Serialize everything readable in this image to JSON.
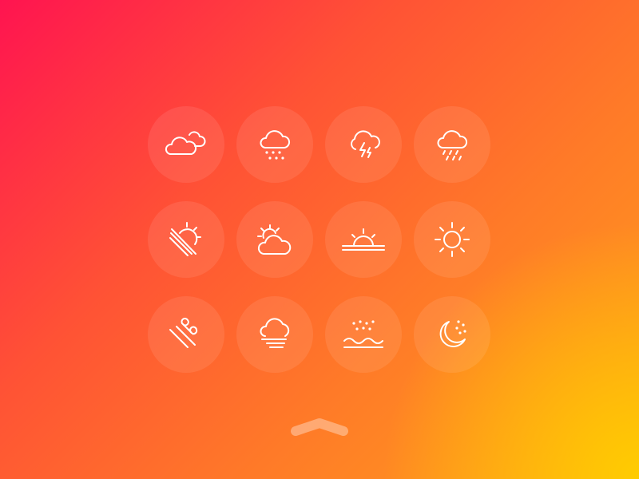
{
  "background": {
    "gradient_colors": [
      "#ff1450",
      "#ff5235",
      "#ff7a28",
      "#ffa31a",
      "#ffcc00"
    ]
  },
  "icon_color": "#ffffff",
  "icons": [
    [
      "cloudy-icon",
      "rain-icon",
      "thunderstorm-icon",
      "heavy-rain-icon"
    ],
    [
      "sunset-haze-icon",
      "partly-cloudy-icon",
      "sunrise-icon",
      "sun-icon"
    ],
    [
      "wind-icon",
      "fog-icon",
      "rain-over-water-icon",
      "clear-night-icon"
    ]
  ],
  "collapse_control": "chevron-up-icon"
}
